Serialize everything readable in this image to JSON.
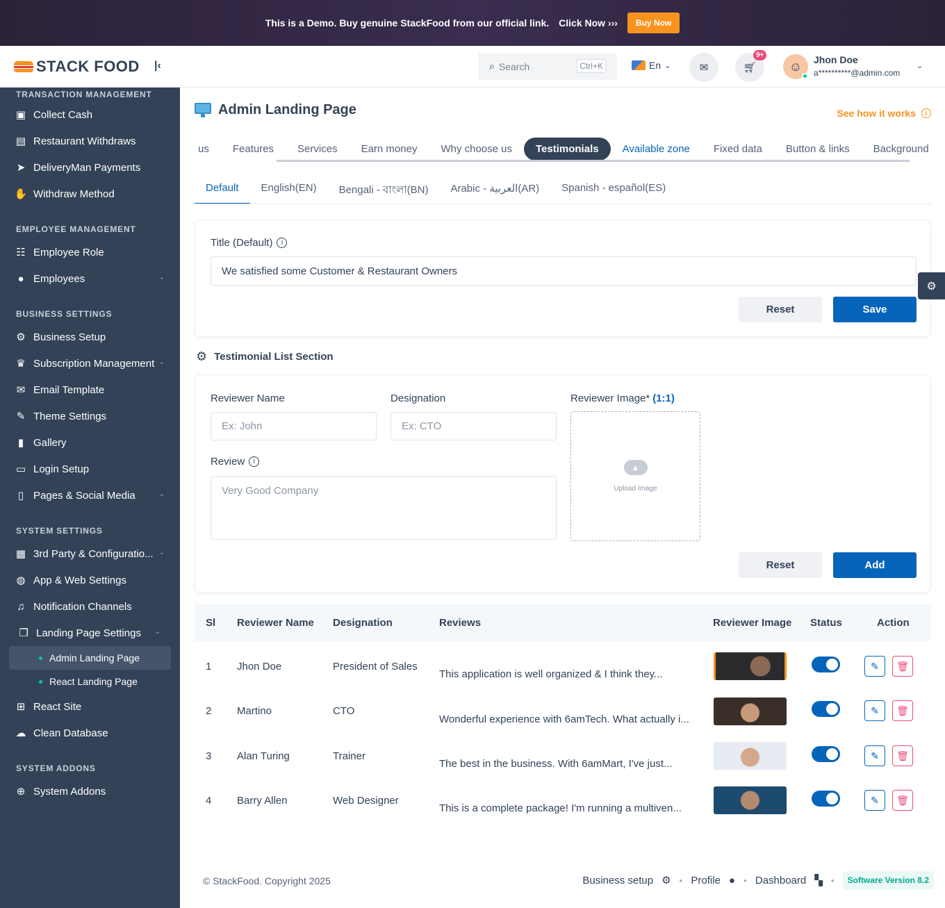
{
  "banner": {
    "text": "This is a Demo. Buy genuine StackFood from our official link.",
    "click": "Click Now ›››",
    "buy_label": "Buy Now"
  },
  "brand": {
    "logo_text": "STACK FOOD"
  },
  "sidebar": {
    "sections": [
      {
        "title": "TRANSACTION MANAGEMENT",
        "items": [
          {
            "label": "Collect Cash",
            "icon": "cash-icon"
          },
          {
            "label": "Restaurant Withdraws",
            "icon": "bank-icon"
          },
          {
            "label": "DeliveryMan Payments",
            "icon": "send-icon"
          },
          {
            "label": "Withdraw Method",
            "icon": "hand-coin-icon"
          }
        ]
      },
      {
        "title": "EMPLOYEE MANAGEMENT",
        "items": [
          {
            "label": "Employee Role",
            "icon": "role-icon"
          },
          {
            "label": "Employees",
            "icon": "user-icon"
          }
        ]
      },
      {
        "title": "BUSINESS SETTINGS",
        "items": [
          {
            "label": "Business Setup",
            "icon": "gear-icon"
          },
          {
            "label": "Subscription Management",
            "icon": "crown-icon"
          },
          {
            "label": "Email Template",
            "icon": "mail-icon"
          },
          {
            "label": "Theme Settings",
            "icon": "brush-icon"
          },
          {
            "label": "Gallery",
            "icon": "gallery-icon"
          },
          {
            "label": "Login Setup",
            "icon": "login-icon"
          },
          {
            "label": "Pages & Social Media",
            "icon": "pages-icon"
          }
        ]
      },
      {
        "title": "SYSTEM SETTINGS",
        "items": [
          {
            "label": "3rd Party & Configuratio...",
            "icon": "config-icon"
          },
          {
            "label": "App & Web Settings",
            "icon": "android-icon"
          },
          {
            "label": "Notification Channels",
            "icon": "bell-icon"
          },
          {
            "label": "Landing Page Settings",
            "icon": "landing-icon"
          }
        ]
      },
      {
        "title": "SYSTEM ADDONS",
        "items": [
          {
            "label": "System Addons",
            "icon": "plus-circle-icon"
          }
        ]
      }
    ],
    "landing_sub": [
      {
        "label": "Admin Landing Page"
      },
      {
        "label": "React Landing Page"
      }
    ],
    "after_landing": [
      {
        "label": "React Site",
        "icon": "react-icon"
      },
      {
        "label": "Clean Database",
        "icon": "cloud-icon"
      }
    ]
  },
  "topbar": {
    "search_placeholder": "Search",
    "search_shortcut": "Ctrl+K",
    "language": "En",
    "cart_badge": "9+",
    "user_name": "Jhon Doe",
    "user_email": "a**********@admin.com"
  },
  "page": {
    "title": "Admin Landing Page",
    "how_link": "See how it works",
    "tabs": [
      "us",
      "Features",
      "Services",
      "Earn money",
      "Why choose us",
      "Testimonials",
      "Available zone",
      "Fixed data",
      "Button & links",
      "Background co"
    ],
    "lang_tabs": [
      "Default",
      "English(EN)",
      "Bengali - বাংলা(BN)",
      "Arabic - العربية(AR)",
      "Spanish - español(ES)"
    ]
  },
  "title_form": {
    "label": "Title (Default)",
    "value": "We satisfied some Customer & Restaurant Owners",
    "reset": "Reset",
    "save": "Save"
  },
  "testimonial_form": {
    "section_title": "Testimonial List Section",
    "name_label": "Reviewer Name",
    "name_placeholder": "Ex: John",
    "designation_label": "Designation",
    "designation_placeholder": "Ex: CTO",
    "image_label": "Reviewer Image*",
    "image_ratio": "(1:1)",
    "upload_text": "Upload Image",
    "review_label": "Review",
    "review_placeholder": "Very Good Company",
    "reset": "Reset",
    "add": "Add"
  },
  "table": {
    "headers": [
      "Sl",
      "Reviewer Name",
      "Designation",
      "Reviews",
      "Reviewer Image",
      "Status",
      "Action"
    ],
    "rows": [
      {
        "sl": "1",
        "name": "Jhon Doe",
        "designation": "President of Sales",
        "review": "This application is well organized & I think they...",
        "status": true
      },
      {
        "sl": "2",
        "name": "Martino",
        "designation": "CTO",
        "review": "Wonderful experience with 6amTech. What actually i...",
        "status": true
      },
      {
        "sl": "3",
        "name": "Alan Turing",
        "designation": "Trainer",
        "review": "The best in the business. With 6amMart, I've just...",
        "status": true
      },
      {
        "sl": "4",
        "name": "Barry Allen",
        "designation": "Web Designer",
        "review": "This is a complete package! I'm running a multiven...",
        "status": true
      }
    ]
  },
  "footer": {
    "copyright": "© StackFood. Copyright 2025",
    "links": [
      "Business setup",
      "Profile",
      "Dashboard"
    ],
    "version": "Software Version 8.2"
  }
}
